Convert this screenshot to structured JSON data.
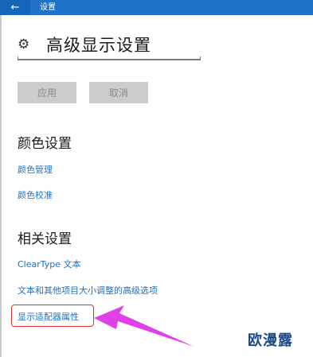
{
  "window": {
    "title": "设置",
    "back_icon": "back-arrow-icon"
  },
  "header": {
    "title": "高级显示设置",
    "icon": "gear-icon"
  },
  "buttons": {
    "apply": "应用",
    "cancel": "取消"
  },
  "color_settings": {
    "heading": "颜色设置",
    "links": [
      "颜色管理",
      "颜色校准"
    ]
  },
  "related_settings": {
    "heading": "相关设置",
    "links": [
      "ClearType 文本",
      "文本和其他项目大小调整的高级选项",
      "显示适配器属性"
    ]
  },
  "watermark": "欧漫露",
  "colors": {
    "titlebar": "#1e73c8",
    "link": "#1f6fc7",
    "annotation": "#e040e8",
    "highlight": "#e03030"
  }
}
